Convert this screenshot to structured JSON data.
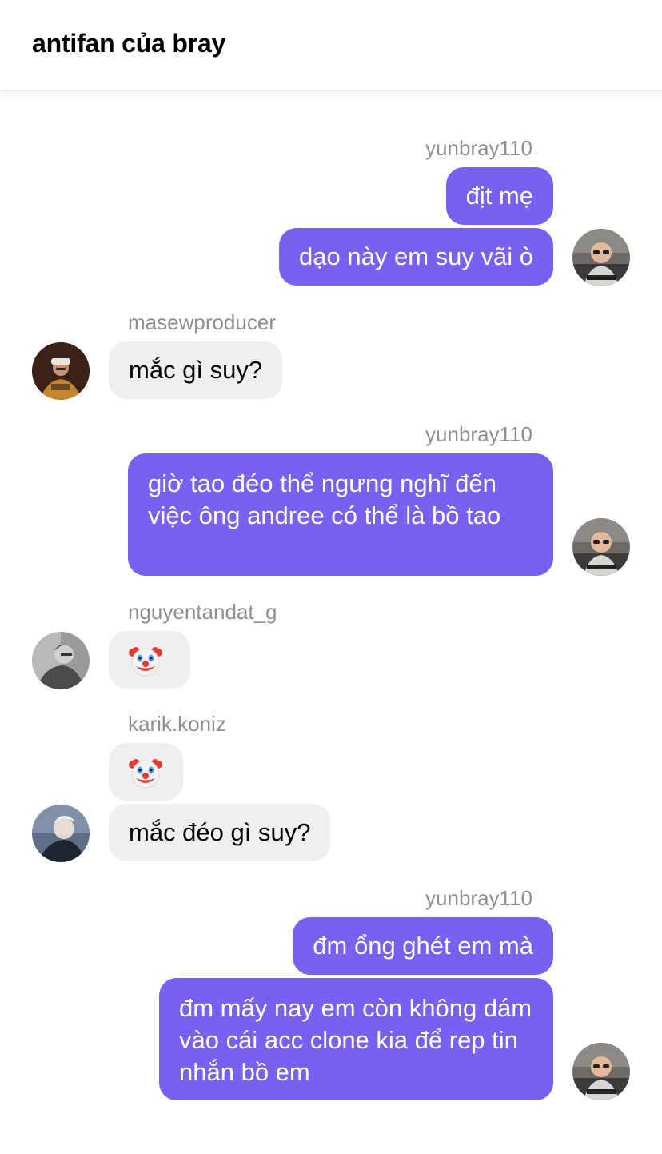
{
  "header": {
    "title": "antifan của bray"
  },
  "messages": [
    {
      "user": "yunbray110",
      "lines": [
        "địt mẹ",
        "dạo này em suy vãi ò"
      ]
    },
    {
      "user": "masewproducer",
      "text": "mắc gì suy?"
    },
    {
      "user": "yunbray110",
      "text": "giờ tao đéo thể ngưng nghĩ đến việc ông andree có thể là bồ tao"
    },
    {
      "user": "nguyentandat_g",
      "emoji": "clown-face"
    },
    {
      "user": "karik.koniz",
      "emoji": "clown-face",
      "text": "mắc đéo gì suy?"
    },
    {
      "user": "yunbray110",
      "lines": [
        "đm ổng ghét em mà",
        "đm mấy nay em còn không dám vào cái acc clone kia để rep tin nhắn bồ em"
      ]
    }
  ],
  "colors": {
    "outgoing_bubble": "#7661f1",
    "incoming_bubble": "#efeff1",
    "username": "#8e8e8e"
  },
  "icons": {
    "emoji": "clown-face"
  }
}
